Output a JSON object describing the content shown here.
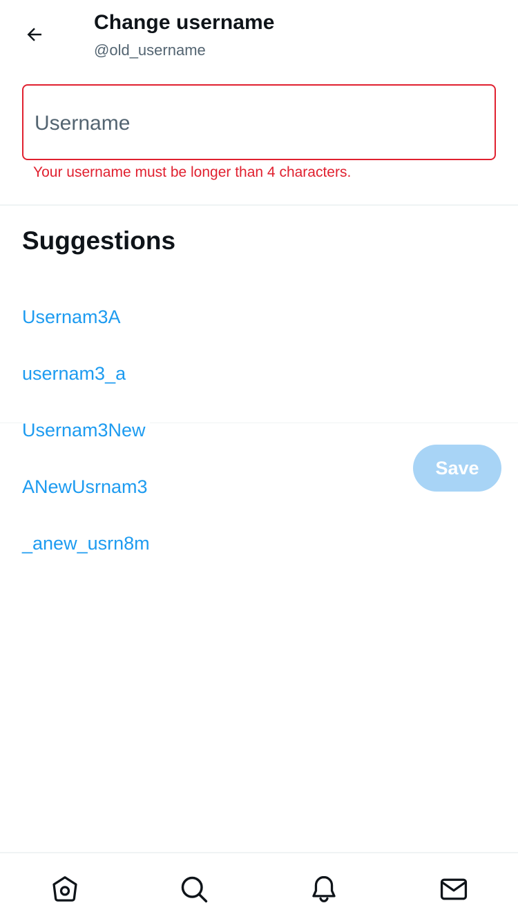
{
  "header": {
    "title": "Change username",
    "subtitle": "@old_username",
    "back_icon": "arrow-left-icon"
  },
  "form": {
    "username_placeholder": "Username",
    "username_value": "",
    "error": "Your username must be longer than 4 characters.",
    "error_color": "#e0202f"
  },
  "suggestions": {
    "heading": "Suggestions",
    "items": [
      "Usernam3A",
      "usernam3_a",
      "Usernam3New",
      "ANewUsrnam3",
      "_anew_usrn8m"
    ],
    "link_color": "#1d9bf0"
  },
  "actions": {
    "save_label": "Save",
    "save_color": "#a8d4f6",
    "save_enabled": false
  },
  "bottom_nav": {
    "items": [
      {
        "name": "home",
        "icon": "home-icon"
      },
      {
        "name": "search",
        "icon": "search-icon"
      },
      {
        "name": "notifications",
        "icon": "bell-icon"
      },
      {
        "name": "messages",
        "icon": "mail-icon"
      }
    ]
  }
}
